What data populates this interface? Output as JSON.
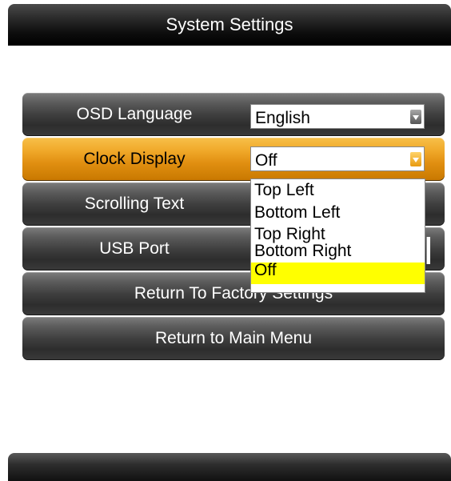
{
  "window": {
    "title": "System Settings"
  },
  "menu": {
    "rows": [
      {
        "label": "OSD Language",
        "value": "English"
      },
      {
        "label": "Clock Display",
        "value": "Off"
      },
      {
        "label": "Scrolling Text"
      },
      {
        "label": "USB Port"
      },
      {
        "label": "Return To Factory Settings"
      },
      {
        "label": "Return to Main Menu"
      }
    ]
  },
  "clock_dropdown": {
    "options": [
      "Top Left",
      "Bottom Left",
      "Top Right",
      "Bottom Right",
      "Off"
    ],
    "highlighted": "Off"
  },
  "colors": {
    "accent": "#f0a92a",
    "highlight": "#ffff00",
    "bar_dark": "#000000"
  },
  "icons": {
    "dropdown": "chevron-down-icon"
  }
}
